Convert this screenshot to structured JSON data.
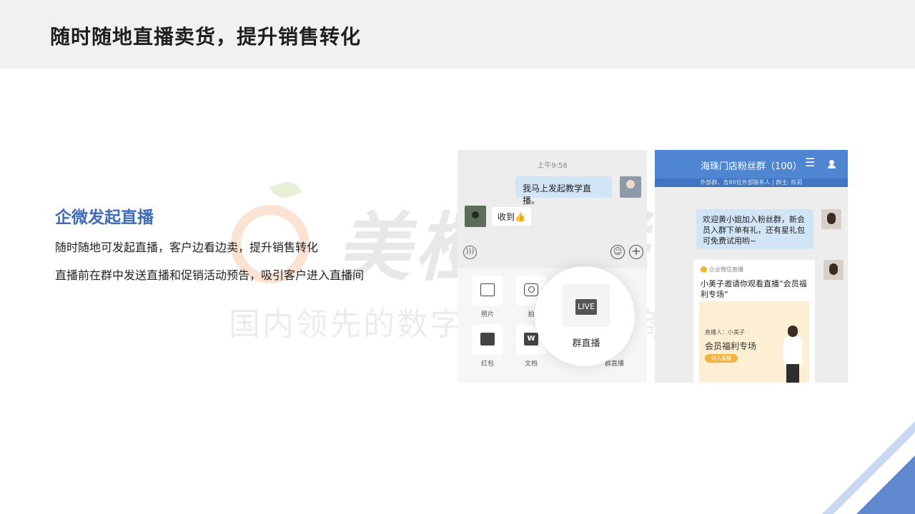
{
  "header": {
    "title": "随时随地直播卖货，提升销售转化"
  },
  "watermark": {
    "brand": "美橙互联",
    "slogan": "国内领先的数字化营销服务商"
  },
  "section": {
    "title": "企微发起直播",
    "line1": "随时随地可发起直播，客户边看边卖，提升销售转化",
    "line2": "直播前在群中发送直播和促销活动预告，吸引客户进入直播间"
  },
  "left_phone": {
    "time": "上午9:58",
    "message_me": "我马上发起教学直播。",
    "message_other": "收到👍",
    "tray": [
      {
        "label": "照片",
        "icon": "image-icon"
      },
      {
        "label": "拍",
        "icon": "camera-icon"
      },
      {
        "label": "红包",
        "icon": "red-packet-icon"
      },
      {
        "label": "文档",
        "icon": "document-icon"
      }
    ],
    "live_badge": "LIVE",
    "live_label": "群直播",
    "group_live_label": "群直播"
  },
  "right_phone": {
    "title": "海珠门店粉丝群（100）",
    "subtitle": "外部群，含89位外部联系人 | 群主: 陈莉",
    "welcome": "欢迎黄小姐加入粉丝群，新会员入群下单有礼，还有星礼包可免费试用哟~",
    "card_source": "企业微信直播",
    "card_text": "小美子邀请你观看直播“会员福利专场”",
    "poster_host": "直播人：小美子",
    "poster_title": "会员福利专场",
    "poster_button": "进入直播"
  },
  "colors": {
    "accent": "#3e6cb8",
    "header_blue": "#4f86d1",
    "bubble": "#d2e5f7"
  }
}
